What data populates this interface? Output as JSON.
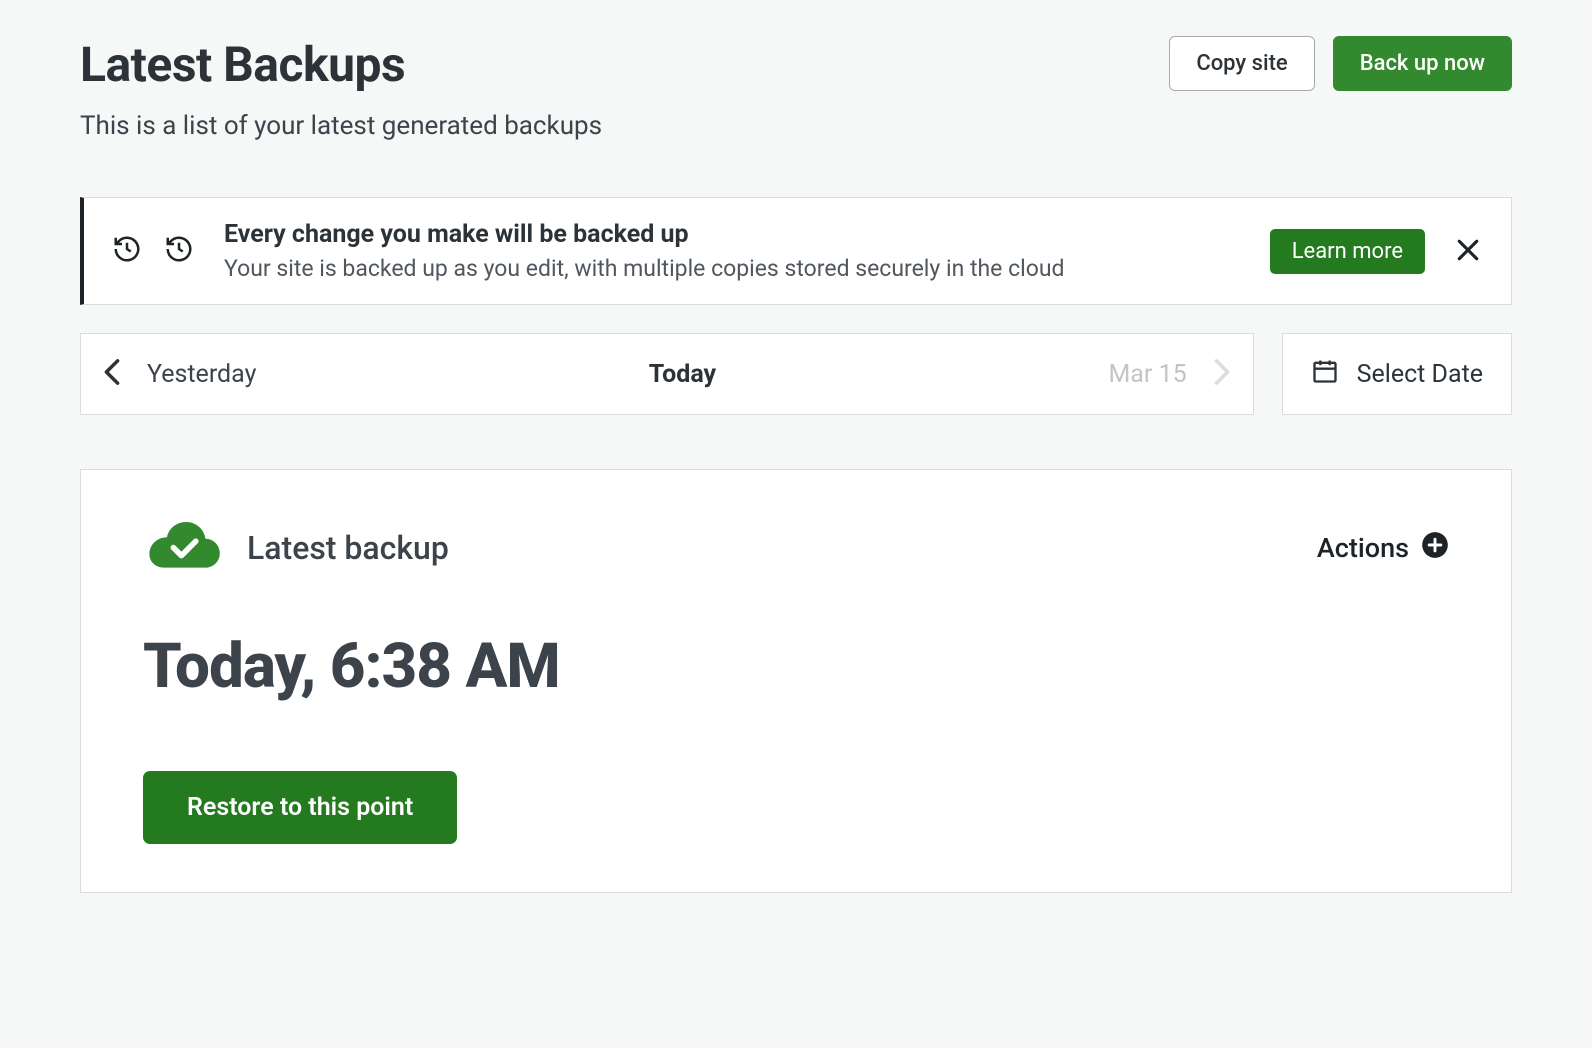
{
  "header": {
    "title": "Latest Backups",
    "subtitle": "This is a list of your latest generated backups",
    "copy_site_label": "Copy site",
    "backup_now_label": "Back up now"
  },
  "notice": {
    "title": "Every change you make will be backed up",
    "desc": "Your site is backed up as you edit, with multiple copies stored securely in the cloud",
    "learn_more_label": "Learn more"
  },
  "date_nav": {
    "prev_label": "Yesterday",
    "current_label": "Today",
    "next_label": "Mar 15",
    "select_date_label": "Select Date"
  },
  "backup_card": {
    "heading": "Latest backup",
    "actions_label": "Actions",
    "timestamp": "Today, 6:38 AM",
    "restore_label": "Restore to this point"
  },
  "colors": {
    "primary_green": "#338a2e",
    "dark_green": "#237a1f"
  }
}
